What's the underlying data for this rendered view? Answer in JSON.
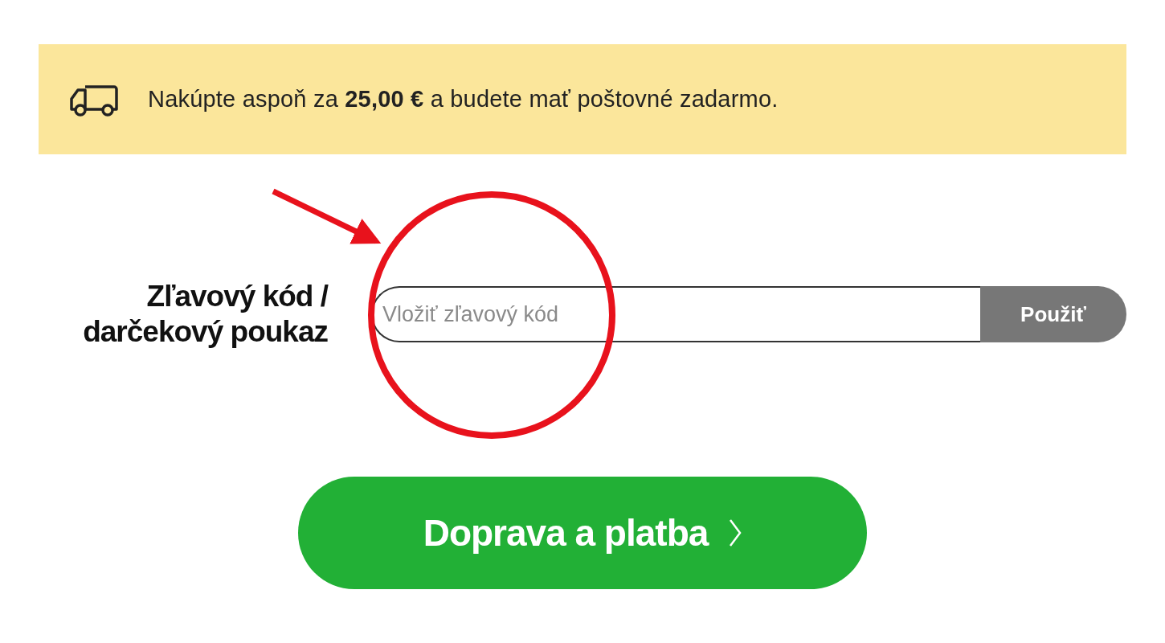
{
  "banner": {
    "message": "Nakúpte aspoň za **25,00 €** a budete mať poštovné zadarmo."
  },
  "discount": {
    "label": "Zľavový kód / darčekový poukaz",
    "placeholder": "Vložiť zľavový kód",
    "apply_button": "Použiť"
  },
  "continue_button": {
    "label": "Doprava a platba"
  }
}
